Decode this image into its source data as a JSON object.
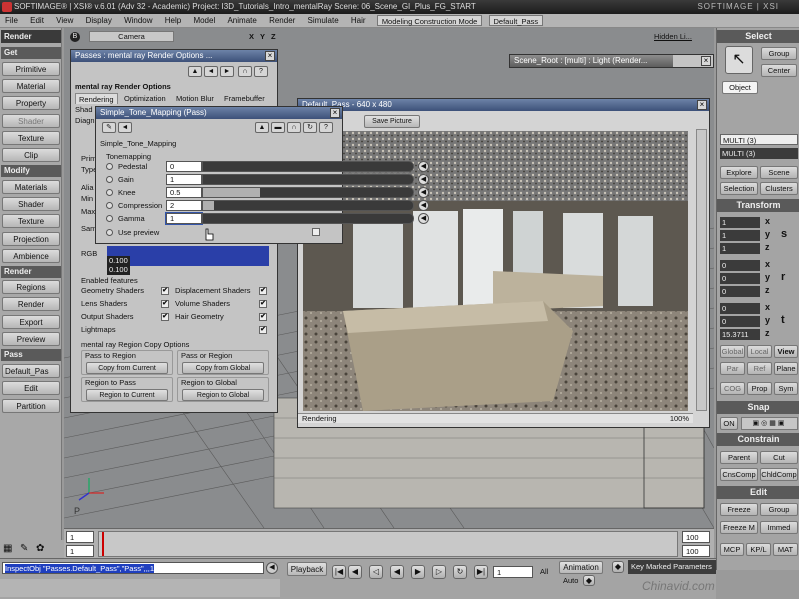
{
  "titlebar": {
    "text": "SOFTIMAGE® | XSI® v.6.01 (Adv 32 - Academic) Project: I3D_Tutorials_Intro_mentalRay    Scene: 06_Scene_GI_Plus_FG_START",
    "brand": "SOFTIMAGE | XSI"
  },
  "menubar": {
    "items": [
      "File",
      "Edit",
      "View",
      "Display",
      "Window",
      "Help",
      "Model",
      "Animate",
      "Render",
      "Simulate",
      "Hair"
    ],
    "construction_mode": "Modeling Construction Mode",
    "pass": "Default_Pass"
  },
  "left_panel": {
    "module": "Render",
    "headers": {
      "get": "Get",
      "modify": "Modify",
      "render": "Render",
      "pass": "Pass"
    },
    "get_buttons": [
      "Primitive",
      "Material",
      "Property",
      "Shader",
      "Texture",
      "Clip"
    ],
    "modify_buttons": [
      "Materials",
      "Shader",
      "Texture",
      "Projection",
      "Ambience"
    ],
    "render_buttons": [
      "Regions",
      "Render",
      "Export",
      "Preview"
    ],
    "pass_field": "Default_Pas",
    "pass_buttons": [
      "Edit",
      "Partition"
    ]
  },
  "viewport": {
    "header": "B",
    "camera": "Camera",
    "axes": [
      "X",
      "Y",
      "Z"
    ],
    "hidden": "Hidden Li...",
    "corner": "P"
  },
  "passes_window": {
    "title": "Passes : mental ray Render Options ...",
    "section": "mental ray Render Options",
    "tabs": [
      "Rendering",
      "Optimization",
      "Motion Blur",
      "Framebuffer"
    ],
    "side_labels": [
      "Shad",
      "Diagn",
      "Prim",
      "Type",
      "Alia",
      "Min L",
      "Max",
      "Sam",
      "RGB"
    ],
    "coord_values": [
      "0.100",
      "0.100"
    ],
    "features_label": "Enabled features",
    "features": [
      {
        "label": "Geometry Shaders",
        "checked": "✔"
      },
      {
        "label": "Displacement Shaders",
        "checked": "✔"
      },
      {
        "label": "Lens Shaders",
        "checked": "✔"
      },
      {
        "label": "Volume Shaders",
        "checked": "✔"
      },
      {
        "label": "Output Shaders",
        "checked": "✔"
      },
      {
        "label": "Hair Geometry",
        "checked": "✔"
      },
      {
        "label": "Lightmaps",
        "checked": "✔"
      }
    ],
    "region_label": "mental ray Region Copy Options",
    "region_groups": [
      {
        "title": "Pass to Region",
        "button": "Copy from Current"
      },
      {
        "title": "Pass or Region",
        "button": "Copy from Global"
      },
      {
        "title": "Region to Pass",
        "button": "Region to Current"
      },
      {
        "title": "Region to Global",
        "button": "Region to Global"
      }
    ]
  },
  "scene_root_window": {
    "title": "Scene_Root : [multi] : Light (Render..."
  },
  "render_window": {
    "title": "Default_Pass - 640 x 480",
    "save_label": "Save Picture",
    "status": "Rendering",
    "percent": "100%"
  },
  "tone_window": {
    "title": "Simple_Tone_Mapping (Pass)",
    "section": "Simple_Tone_Mapping",
    "group": "Tonemapping",
    "rows": [
      {
        "name": "Pedestal",
        "value": "0",
        "fraction": 0.0
      },
      {
        "name": "Gain",
        "value": "1",
        "fraction": 0.0
      },
      {
        "name": "Knee",
        "value": "0.5",
        "fraction": 0.27
      },
      {
        "name": "Compression",
        "value": "2",
        "fraction": 0.05
      },
      {
        "name": "Gamma",
        "value": "1",
        "fraction": 0.0
      }
    ],
    "use_preview": "Use preview"
  },
  "right_panel": {
    "select_header": "Select",
    "group_btn": "Group",
    "center_btn": "Center",
    "object_btn": "Object",
    "multi1": "MULTI (3)",
    "multi2": "MULTI (3)",
    "explore": "Explore",
    "scene": "Scene",
    "selection": "Selection",
    "clusters": "Clusters",
    "transform_header": "Transform",
    "scl_vals": [
      "1",
      "1",
      "1"
    ],
    "rot_vals": [
      "0",
      "0",
      "0"
    ],
    "pos_vals": [
      "0",
      "0",
      "15.3711"
    ],
    "axes": [
      "x",
      "y",
      "z"
    ],
    "side_letters": [
      "s",
      "r",
      "t"
    ],
    "global": "Global",
    "local": "Local",
    "view": "View",
    "par": "Par",
    "ref": "Ref",
    "plane": "Plane",
    "cog": "COG",
    "prop": "Prop",
    "sym": "Sym",
    "snap_header": "Snap",
    "on": "ON",
    "constrain_header": "Constrain",
    "parent": "Parent",
    "cut": "Cut",
    "cnscomp": "CnsComp",
    "childcomp": "ChldComp",
    "edit_header": "Edit",
    "freeze": "Freeze",
    "group": "Group",
    "freezem": "Freeze M",
    "immed": "Immed",
    "mcp": "MCP",
    "kpl": "KP/L",
    "mat": "MAT"
  },
  "timeline": {
    "start": "1",
    "start2": "1",
    "end": "100",
    "end2": "100"
  },
  "playback": {
    "script": "InspectObj \"Passes.Default_Pass\",\"Pass\",,,1",
    "playback_label": "Playback",
    "frame": "1",
    "all": "All",
    "animation": "Animation",
    "auto": "Auto",
    "key_marked": "Key Marked Parameters"
  },
  "watermark": "Chinavid.com"
}
